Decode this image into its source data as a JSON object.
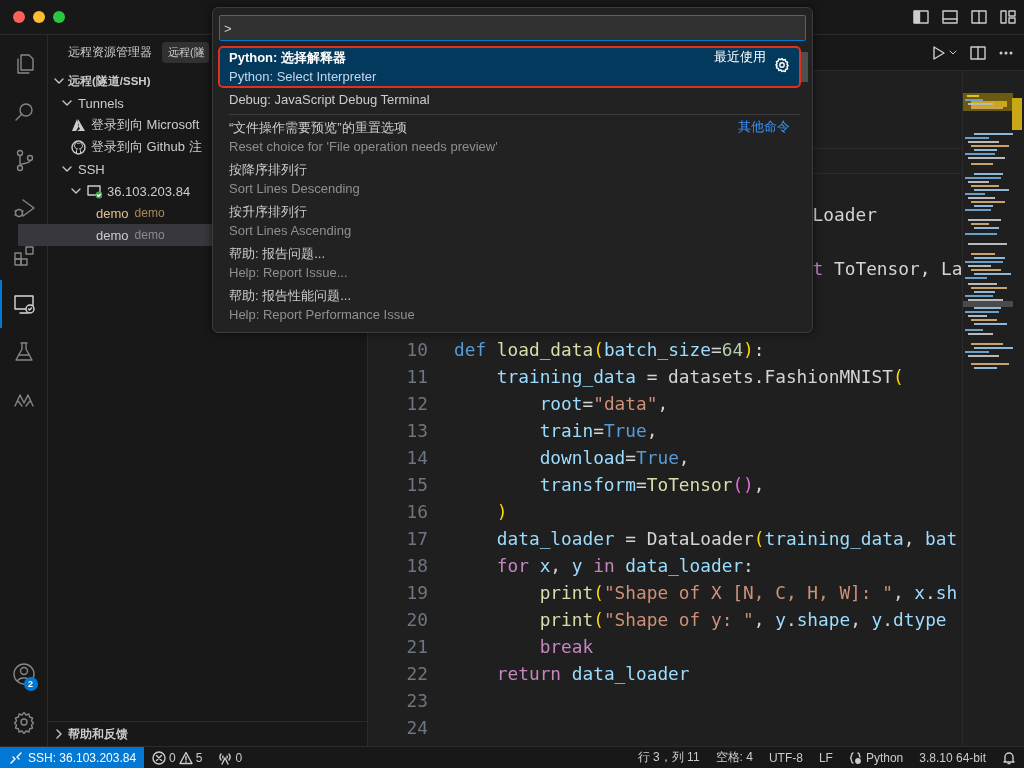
{
  "activity_bar": {
    "items": [
      {
        "selected": false
      },
      {
        "selected": false
      },
      {
        "selected": false
      },
      {
        "selected": false
      },
      {
        "selected": false
      },
      {
        "selected": true
      },
      {
        "selected": false
      },
      {
        "selected": false
      }
    ],
    "account_badge": "2"
  },
  "sidebar": {
    "title": "远程资源管理器",
    "dropdown": "远程(隧",
    "section": "远程(隧道/SSH)",
    "section_expanded": true,
    "tree": [
      {
        "label": "Tunnels",
        "expanded": true,
        "children": [
          {
            "label": "登录到向 Microsoft"
          },
          {
            "label": "登录到向 Github 注"
          }
        ]
      },
      {
        "label": "SSH",
        "expanded": true,
        "children": [
          {
            "label": "36.103.203.84",
            "expanded": true,
            "children": [
              {
                "label": "demo",
                "description": "demo",
                "highlighted": true,
                "selected": false
              },
              {
                "label": "demo",
                "description": "demo",
                "highlighted": false,
                "selected": true
              }
            ]
          }
        ]
      }
    ],
    "footer_section": {
      "label": "帮助和反馈",
      "expanded": false
    }
  },
  "command_palette": {
    "value": ">",
    "items": [
      {
        "label": "Python: 选择解释器",
        "detail": "Python: Select Interpreter",
        "group_label": "最近使用",
        "selected": true,
        "separator_after": false
      },
      {
        "label": "Debug: JavaScript Debug Terminal",
        "selected": false,
        "separator_after": true
      },
      {
        "label": "“文件操作需要预览”的重置选项",
        "detail": "Reset choice for 'File operation needs preview'",
        "group_label": "其他命令",
        "selected": false,
        "separator_after": false
      },
      {
        "label": "按降序排列行",
        "detail": "Sort Lines Descending",
        "selected": false,
        "separator_after": false
      },
      {
        "label": "按升序排列行",
        "detail": "Sort Lines Ascending",
        "selected": false,
        "separator_after": false
      },
      {
        "label": "帮助: 报告问题...",
        "detail": "Help: Report Issue...",
        "selected": false,
        "separator_after": false
      },
      {
        "label": "帮助: 报告性能问题...",
        "detail": "Help: Report Performance Issue",
        "selected": false,
        "separator_after": false
      }
    ]
  },
  "editor": {
    "lines": [
      {
        "kind": "partial",
        "tokens": [
          {
            "kind": "plain",
            "text": "Loader"
          }
        ]
      },
      {
        "kind": "partial"
      },
      {
        "kind": "partial",
        "tokens": [
          {
            "kind": "keyword",
            "text": "t"
          },
          {
            "kind": "plain",
            "text": " ToTensor, La"
          }
        ]
      },
      {
        "kind": "partial"
      },
      {
        "kind": "partial"
      },
      {
        "kind": "full",
        "number": "10",
        "tokens": [
          {
            "kind": "storage",
            "text": "def"
          },
          {
            "kind": "function",
            "text": " load_data"
          },
          {
            "kind": "bracket1",
            "text": "("
          },
          {
            "kind": "variable",
            "text": "batch_size"
          },
          {
            "kind": "plain",
            "text": "="
          },
          {
            "kind": "number",
            "text": "64"
          },
          {
            "kind": "bracket1",
            "text": ")"
          },
          {
            "kind": "plain",
            "text": ":"
          }
        ]
      },
      {
        "kind": "full",
        "number": "11",
        "tokens": [
          {
            "kind": "variable",
            "text": "    training_data"
          },
          {
            "kind": "plain",
            "text": " = datasets."
          },
          {
            "kind": "class",
            "text": "FashionMNIST"
          },
          {
            "kind": "bracket1",
            "text": "("
          }
        ]
      },
      {
        "kind": "full",
        "number": "12",
        "tokens": [
          {
            "kind": "variable",
            "text": "        root"
          },
          {
            "kind": "plain",
            "text": "="
          },
          {
            "kind": "string",
            "text": "\"data\""
          },
          {
            "kind": "plain",
            "text": ","
          }
        ]
      },
      {
        "kind": "full",
        "number": "13",
        "tokens": [
          {
            "kind": "variable",
            "text": "        train"
          },
          {
            "kind": "plain",
            "text": "="
          },
          {
            "kind": "storage",
            "text": "True"
          },
          {
            "kind": "plain",
            "text": ","
          }
        ]
      },
      {
        "kind": "full",
        "number": "14",
        "tokens": [
          {
            "kind": "variable",
            "text": "        download"
          },
          {
            "kind": "plain",
            "text": "="
          },
          {
            "kind": "storage",
            "text": "True"
          },
          {
            "kind": "plain",
            "text": ","
          }
        ]
      },
      {
        "kind": "full",
        "number": "15",
        "tokens": [
          {
            "kind": "variable",
            "text": "        transform"
          },
          {
            "kind": "plain",
            "text": "="
          },
          {
            "kind": "function",
            "text": "ToTensor"
          },
          {
            "kind": "bracket2",
            "text": "()"
          },
          {
            "kind": "plain",
            "text": ","
          }
        ]
      },
      {
        "kind": "full",
        "number": "16",
        "tokens": [
          {
            "kind": "bracket1",
            "text": "    )"
          }
        ]
      },
      {
        "kind": "full",
        "number": "17",
        "tokens": [
          {
            "kind": "variable",
            "text": "    data_loader"
          },
          {
            "kind": "plain",
            "text": " = "
          },
          {
            "kind": "class",
            "text": "DataLoader"
          },
          {
            "kind": "bracket1",
            "text": "("
          },
          {
            "kind": "variable",
            "text": "training_data"
          },
          {
            "kind": "plain",
            "text": ", "
          },
          {
            "kind": "variable",
            "text": "bat"
          }
        ]
      },
      {
        "kind": "full",
        "number": "18",
        "tokens": [
          {
            "kind": "keyword",
            "text": "    for"
          },
          {
            "kind": "variable",
            "text": " x"
          },
          {
            "kind": "plain",
            "text": ", "
          },
          {
            "kind": "variable",
            "text": "y"
          },
          {
            "kind": "keyword",
            "text": " in"
          },
          {
            "kind": "variable",
            "text": " data_loader"
          },
          {
            "kind": "plain",
            "text": ":"
          }
        ]
      },
      {
        "kind": "full",
        "number": "19",
        "tokens": [
          {
            "kind": "function",
            "text": "        print"
          },
          {
            "kind": "bracket1",
            "text": "("
          },
          {
            "kind": "string",
            "text": "\"Shape of X [N, C, H, W]: \""
          },
          {
            "kind": "plain",
            "text": ", "
          },
          {
            "kind": "variable",
            "text": "x"
          },
          {
            "kind": "plain",
            "text": "."
          },
          {
            "kind": "variable",
            "text": "sh"
          }
        ]
      },
      {
        "kind": "full",
        "number": "20",
        "tokens": [
          {
            "kind": "function",
            "text": "        print"
          },
          {
            "kind": "bracket1",
            "text": "("
          },
          {
            "kind": "string",
            "text": "\"Shape of y: \""
          },
          {
            "kind": "plain",
            "text": ", "
          },
          {
            "kind": "variable",
            "text": "y"
          },
          {
            "kind": "plain",
            "text": "."
          },
          {
            "kind": "variable",
            "text": "shape"
          },
          {
            "kind": "plain",
            "text": ", "
          },
          {
            "kind": "variable",
            "text": "y"
          },
          {
            "kind": "plain",
            "text": "."
          },
          {
            "kind": "variable",
            "text": "dtype"
          }
        ]
      },
      {
        "kind": "full",
        "number": "21",
        "tokens": [
          {
            "kind": "keyword",
            "text": "        break"
          }
        ]
      },
      {
        "kind": "full",
        "number": "22",
        "tokens": [
          {
            "kind": "keyword",
            "text": "    return"
          },
          {
            "kind": "variable",
            "text": " data_loader"
          }
        ]
      },
      {
        "kind": "full",
        "number": "23"
      },
      {
        "kind": "full",
        "number": "24"
      }
    ]
  },
  "status_bar": {
    "remote": "SSH: 36.103.203.84",
    "errors": "0",
    "warnings": "5",
    "ports": "0",
    "right": [
      "行 3，列 11",
      "空格: 4",
      "UTF-8",
      "LF",
      "Python",
      "3.8.10 64-bit"
    ]
  }
}
